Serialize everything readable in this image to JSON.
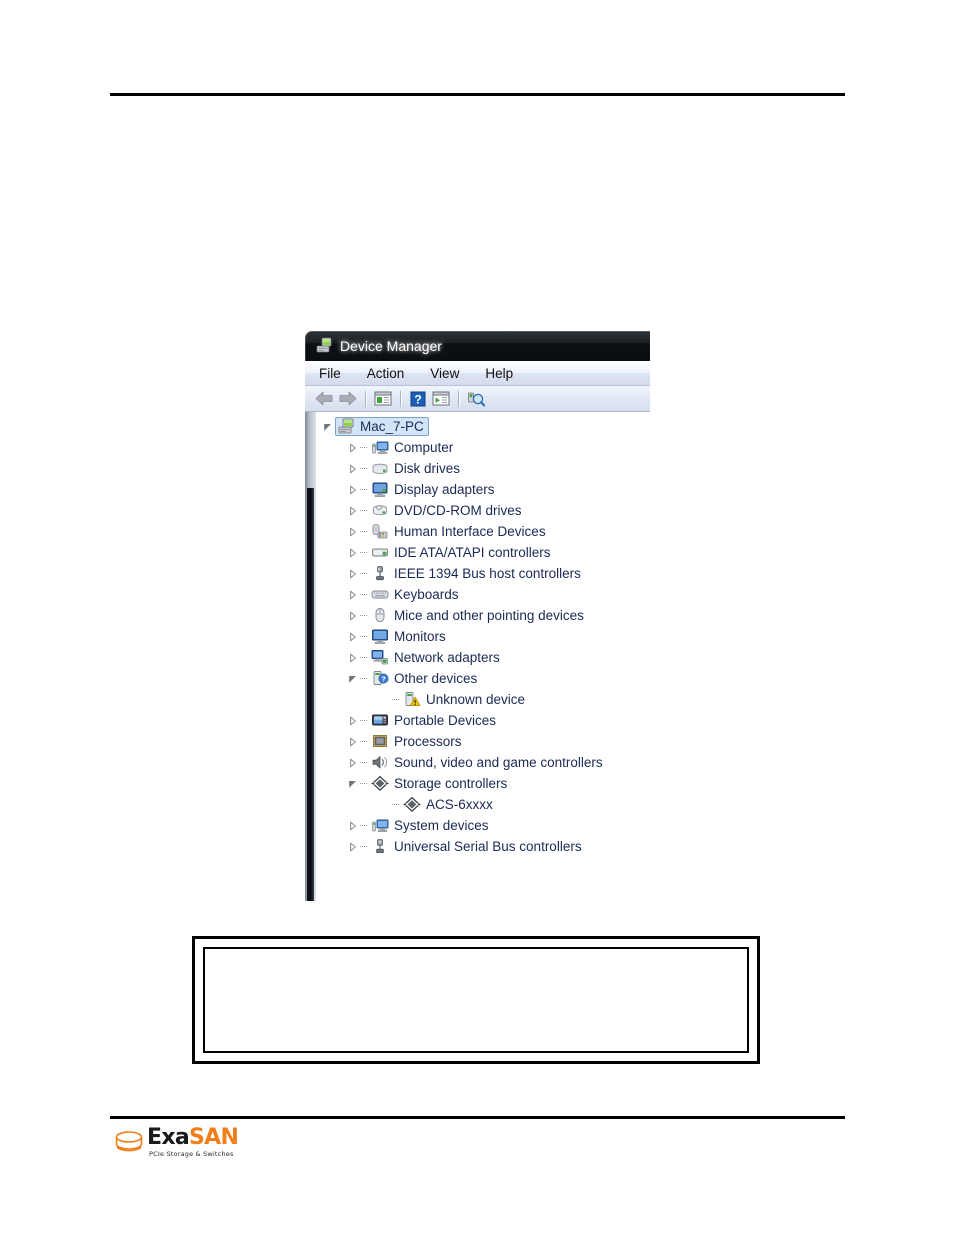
{
  "page": {
    "header_rule": true,
    "footer_rule": true
  },
  "callout": {
    "text": ""
  },
  "footer": {
    "logo_exa": "Exa",
    "logo_san": "SAN",
    "tagline": "PCIe Storage & Switches",
    "brand_color": "#ef7f1a",
    "text_color": "#1a1a1a"
  },
  "device_manager": {
    "title": "Device Manager",
    "title_icon": "device-manager-icon",
    "menu": [
      {
        "label": "File"
      },
      {
        "label": "Action"
      },
      {
        "label": "View"
      },
      {
        "label": "Help"
      }
    ],
    "toolbar": [
      {
        "name": "back-icon",
        "tooltip": "Back"
      },
      {
        "name": "forward-icon",
        "tooltip": "Forward"
      },
      {
        "name": "separator"
      },
      {
        "name": "properties-icon",
        "tooltip": "Properties"
      },
      {
        "name": "separator"
      },
      {
        "name": "help-icon",
        "tooltip": "Help"
      },
      {
        "name": "update-driver-icon",
        "tooltip": "Update Driver Software"
      },
      {
        "name": "separator"
      },
      {
        "name": "scan-hardware-changes-icon",
        "tooltip": "Scan for hardware changes"
      }
    ],
    "tree": [
      {
        "label": "Mac_7-PC",
        "level": 0,
        "state": "expanded",
        "selected": true,
        "icon": "computer-root-icon"
      },
      {
        "label": "Computer",
        "level": 1,
        "state": "collapsed",
        "selected": false,
        "icon": "computer-icon"
      },
      {
        "label": "Disk drives",
        "level": 1,
        "state": "collapsed",
        "selected": false,
        "icon": "disk-drive-icon"
      },
      {
        "label": "Display adapters",
        "level": 1,
        "state": "collapsed",
        "selected": false,
        "icon": "display-adapter-icon"
      },
      {
        "label": "DVD/CD-ROM drives",
        "level": 1,
        "state": "collapsed",
        "selected": false,
        "icon": "dvd-drive-icon"
      },
      {
        "label": "Human Interface Devices",
        "level": 1,
        "state": "collapsed",
        "selected": false,
        "icon": "hid-icon"
      },
      {
        "label": "IDE ATA/ATAPI controllers",
        "level": 1,
        "state": "collapsed",
        "selected": false,
        "icon": "ide-controller-icon"
      },
      {
        "label": "IEEE 1394 Bus host controllers",
        "level": 1,
        "state": "collapsed",
        "selected": false,
        "icon": "firewire-icon"
      },
      {
        "label": "Keyboards",
        "level": 1,
        "state": "collapsed",
        "selected": false,
        "icon": "keyboard-icon"
      },
      {
        "label": "Mice and other pointing devices",
        "level": 1,
        "state": "collapsed",
        "selected": false,
        "icon": "mouse-icon"
      },
      {
        "label": "Monitors",
        "level": 1,
        "state": "collapsed",
        "selected": false,
        "icon": "monitor-icon"
      },
      {
        "label": "Network adapters",
        "level": 1,
        "state": "collapsed",
        "selected": false,
        "icon": "network-adapter-icon"
      },
      {
        "label": "Other devices",
        "level": 1,
        "state": "expanded",
        "selected": false,
        "icon": "other-device-icon"
      },
      {
        "label": "Unknown device",
        "level": 2,
        "state": "leaf",
        "selected": false,
        "icon": "unknown-device-warning-icon"
      },
      {
        "label": "Portable Devices",
        "level": 1,
        "state": "collapsed",
        "selected": false,
        "icon": "portable-device-icon"
      },
      {
        "label": "Processors",
        "level": 1,
        "state": "collapsed",
        "selected": false,
        "icon": "processor-icon"
      },
      {
        "label": "Sound, video and game controllers",
        "level": 1,
        "state": "collapsed",
        "selected": false,
        "icon": "sound-controller-icon"
      },
      {
        "label": "Storage controllers",
        "level": 1,
        "state": "expanded",
        "selected": false,
        "icon": "storage-controller-icon"
      },
      {
        "label": "ACS-6xxxx",
        "level": 2,
        "state": "leaf",
        "selected": false,
        "icon": "storage-controller-icon"
      },
      {
        "label": "System devices",
        "level": 1,
        "state": "collapsed",
        "selected": false,
        "icon": "system-device-icon"
      },
      {
        "label": "Universal Serial Bus controllers",
        "level": 1,
        "state": "collapsed",
        "selected": false,
        "icon": "usb-controller-icon"
      }
    ]
  }
}
